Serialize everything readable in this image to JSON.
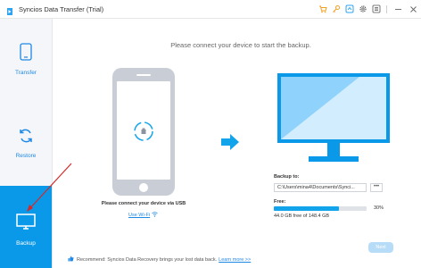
{
  "window": {
    "title": "Syncios Data Transfer (Trial)"
  },
  "titlebar_icons": [
    "cart-icon",
    "key-icon",
    "upgrade-icon",
    "settings-icon",
    "menu-icon"
  ],
  "sidebar": {
    "items": [
      {
        "label": "Transfer",
        "icon": "phone-icon",
        "active": false
      },
      {
        "label": "Restore",
        "icon": "restore-icon",
        "active": false
      },
      {
        "label": "Backup",
        "icon": "monitor-icon",
        "active": true
      }
    ]
  },
  "main": {
    "instruction": "Please connect your device to start the backup.",
    "usb_text": "Please connect your device via USB",
    "wifi_link": "Use Wi-Fi"
  },
  "backup": {
    "backup_to_label": "Backup to:",
    "path": "C:\\Users\\mina4\\Documents\\Synci...",
    "browse_label": "•••",
    "free_label": "Free:",
    "free_percent": 30,
    "free_percent_text": "30%",
    "free_text": "44.0 GB free of 148.4 GB"
  },
  "next_button": "Next",
  "recommend": {
    "text": "Recommend: Syncios Data Recovery brings your lost data back.",
    "link": "Learn more >>"
  },
  "colors": {
    "accent": "#0a99e8",
    "sidebar_bg": "#f4f6f9",
    "device_gray": "#c9ced6"
  }
}
